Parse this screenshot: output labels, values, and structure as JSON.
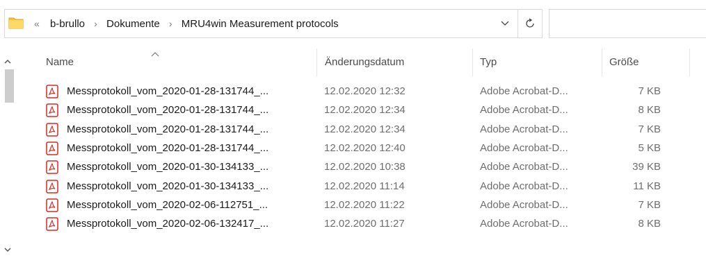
{
  "address_bar": {
    "overflow_chevron": "«",
    "breadcrumbs": [
      "b-brullo",
      "Dokumente",
      "MRU4win Measurement protocols"
    ],
    "separator": "›",
    "dropdown_icon": "chevron-down-icon",
    "refresh_icon": "refresh-icon"
  },
  "columns": {
    "name": "Name",
    "date": "Änderungsdatum",
    "type": "Typ",
    "size": "Größe"
  },
  "files": [
    {
      "name": "Messprotokoll_vom_2020-01-28-131744_...",
      "date": "12.02.2020 12:32",
      "type": "Adobe Acrobat-D...",
      "size": "7 KB"
    },
    {
      "name": "Messprotokoll_vom_2020-01-28-131744_...",
      "date": "12.02.2020 12:34",
      "type": "Adobe Acrobat-D...",
      "size": "8 KB"
    },
    {
      "name": "Messprotokoll_vom_2020-01-28-131744_...",
      "date": "12.02.2020 12:34",
      "type": "Adobe Acrobat-D...",
      "size": "7 KB"
    },
    {
      "name": "Messprotokoll_vom_2020-01-28-131744_...",
      "date": "12.02.2020 12:40",
      "type": "Adobe Acrobat-D...",
      "size": "5 KB"
    },
    {
      "name": "Messprotokoll_vom_2020-01-30-134133_...",
      "date": "12.02.2020 10:38",
      "type": "Adobe Acrobat-D...",
      "size": "39 KB"
    },
    {
      "name": "Messprotokoll_vom_2020-01-30-134133_...",
      "date": "12.02.2020 11:14",
      "type": "Adobe Acrobat-D...",
      "size": "11 KB"
    },
    {
      "name": "Messprotokoll_vom_2020-02-06-112751_...",
      "date": "12.02.2020 11:22",
      "type": "Adobe Acrobat-D...",
      "size": "7 KB"
    },
    {
      "name": "Messprotokoll_vom_2020-02-06-132417_...",
      "date": "12.02.2020 11:27",
      "type": "Adobe Acrobat-D...",
      "size": "8 KB"
    }
  ],
  "colors": {
    "pdf_red": "#d82a20",
    "folder_yellow": "#f5c542",
    "secondary_text": "#6d6d6d"
  }
}
